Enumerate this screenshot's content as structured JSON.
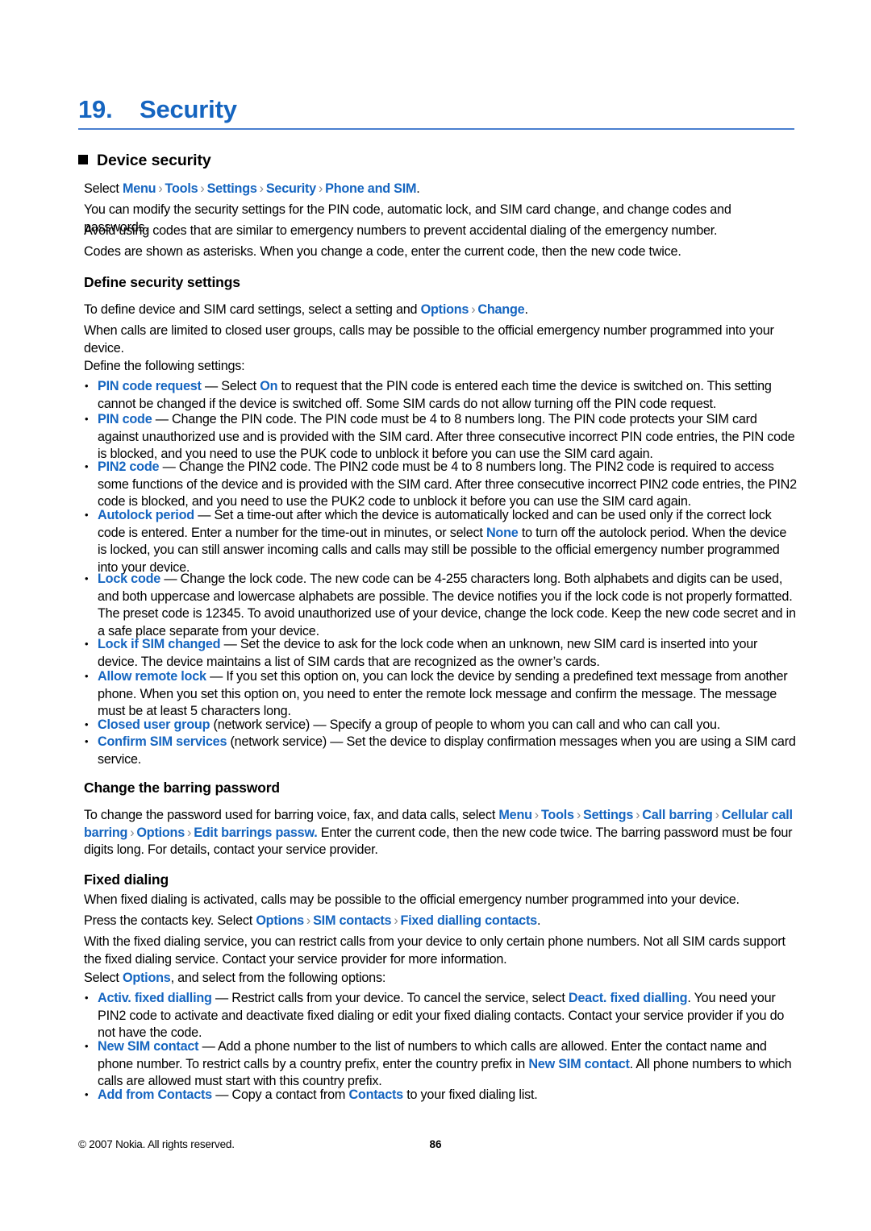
{
  "document": {
    "chapter_number": "19.",
    "chapter_title": "Security",
    "page_number": "86",
    "copyright": "© 2007 Nokia. All rights reserved.",
    "accent_color": "#1565C0",
    "rule_color": "#4a7fcf",
    "text_color": "#000000",
    "separator_color": "#8a8a8a"
  },
  "sections": {
    "device_security": {
      "heading": "Device security",
      "breadcrumb": {
        "lead": "Select ",
        "items": [
          "Menu",
          "Tools",
          "Settings",
          "Security",
          "Phone and SIM"
        ],
        "separator": "›",
        "trailing": "."
      },
      "paragraphs": [
        "You can modify the security settings for the PIN code, automatic lock, and SIM card change, and change codes and passwords.",
        "Avoid using codes that are similar to emergency numbers to prevent accidental dialing of the emergency number.",
        "Codes are shown as asterisks. When you change a code, enter the current code, then the new code twice."
      ]
    },
    "define_security_settings": {
      "heading": "Define security settings",
      "intro_1_pre": "To define device and SIM card settings, select a setting and ",
      "intro_1_ui_a": "Options",
      "intro_1_ui_b": "Change",
      "intro_1_post": ".",
      "intro_2": "When calls are limited to closed user groups, calls may be possible to the official emergency number programmed into your device.",
      "intro_3": "Define the following settings:",
      "bullets": [
        {
          "term": "PIN code request",
          "dash": " — ",
          "text_pre": "Select ",
          "inline_ui": "On",
          "text_post": " to request that the PIN code is entered each time the device is switched on. This setting cannot be changed if the device is switched off. Some SIM cards do not allow turning off the PIN code request."
        },
        {
          "term": "PIN code",
          "dash": " — ",
          "text_pre": "Change the PIN code. The PIN code must be 4 to 8 numbers long. The PIN code protects your SIM card against unauthorized use and is provided with the SIM card. After three consecutive incorrect PIN code entries, the PIN code is blocked, and you need to use the PUK code to unblock it before you can use the SIM card again.",
          "inline_ui": "",
          "text_post": ""
        },
        {
          "term": "PIN2 code",
          "dash": " — ",
          "text_pre": "Change the PIN2 code. The PIN2 code must be 4 to 8 numbers long. The PIN2 code is required to access some functions of the device and is provided with the SIM card. After three consecutive incorrect PIN2 code entries, the PIN2 code is blocked, and you need to use the PUK2 code to unblock it before you can use the SIM card again.",
          "inline_ui": "",
          "text_post": ""
        },
        {
          "term": "Autolock period",
          "dash": "  — ",
          "text_pre": "Set a time-out after which the device is automatically locked and can be used only if the correct lock code is entered. Enter a number for the time-out in minutes, or select ",
          "inline_ui": "None",
          "text_post": " to turn off the autolock period. When the device is locked, you can still answer incoming calls and calls may still be possible to the official emergency number programmed into your device."
        },
        {
          "term": "Lock code",
          "dash": " — ",
          "text_pre": "Change the lock code. The new code can be 4-255 characters long. Both alphabets and digits can be used, and both uppercase and lowercase alphabets are possible. The device notifies you if the lock code is not properly formatted. The preset code is 12345. To avoid unauthorized use of your device, change the lock code. Keep the new code secret and in a safe place separate from your device.",
          "inline_ui": "",
          "text_post": ""
        },
        {
          "term": "Lock if SIM changed",
          "dash": " — ",
          "text_pre": "Set the device to ask for the lock code when an unknown, new SIM card is inserted into your device. The device maintains a list of SIM cards that are recognized as the owner’s cards.",
          "inline_ui": "",
          "text_post": ""
        },
        {
          "term": "Allow remote lock",
          "dash": " — ",
          "text_pre": "If you set this option on, you can lock the device by sending a predefined text message from another phone. When you set this option on, you need to enter the remote lock message and confirm the message. The message must be at least 5 characters long.",
          "inline_ui": "",
          "text_post": ""
        },
        {
          "term": "Closed user group",
          "dash": " (network service) — ",
          "text_pre": "Specify a group of people to whom you can call and who can call you.",
          "inline_ui": "",
          "text_post": ""
        },
        {
          "term": "Confirm SIM services",
          "dash": " (network service) — ",
          "text_pre": "Set the device to display confirmation messages when you are using a SIM card service.",
          "inline_ui": "",
          "text_post": ""
        }
      ]
    },
    "change_barring_password": {
      "heading": "Change the barring password",
      "body_pre": "To change the password used for barring voice, fax, and data calls, select ",
      "breadcrumb_items": [
        "Menu",
        "Tools",
        "Settings",
        "Call barring",
        "Cellular call barring",
        "Options",
        "Edit barrings passw."
      ],
      "body_post": " Enter the current code, then the new code twice. The barring password must be four digits long. For details, contact your service provider."
    },
    "fixed_dialing": {
      "heading": "Fixed dialing",
      "paragraph_1": "When fixed dialing is activated, calls may be possible to the official emergency number programmed into your device.",
      "paragraph_2_pre": "Press the contacts key. Select ",
      "paragraph_2_items": [
        "Options",
        "SIM contacts",
        "Fixed dialling contacts"
      ],
      "paragraph_2_post": ".",
      "paragraph_3": "With the fixed dialing service, you can restrict calls from your device to only certain phone numbers. Not all SIM cards support the fixed dialing service. Contact your service provider for more information.",
      "paragraph_4_pre": "Select ",
      "paragraph_4_ui": "Options",
      "paragraph_4_post": ", and select from the following options:",
      "bullets": [
        {
          "term": "Activ. fixed dialling",
          "dash": " — ",
          "text_pre": "Restrict calls from your device. To cancel the service, select ",
          "inline_ui": "Deact. fixed dialling",
          "text_post": ". You need your PIN2 code to activate and deactivate fixed dialing or edit your fixed dialing contacts. Contact your service provider if you do not have the code."
        },
        {
          "term": "New SIM contact",
          "dash": " — ",
          "text_pre": "Add a phone number to the list of numbers to which calls are allowed. Enter the contact name and phone number. To restrict calls by a country prefix, enter the country prefix in ",
          "inline_ui": "New SIM contact",
          "text_post": ". All phone numbers to which calls are allowed must start with this country prefix."
        },
        {
          "term": "Add from Contacts",
          "dash": " — ",
          "text_pre": "Copy a contact from ",
          "inline_ui": "Contacts",
          "text_post": " to your fixed dialing list."
        }
      ]
    }
  }
}
